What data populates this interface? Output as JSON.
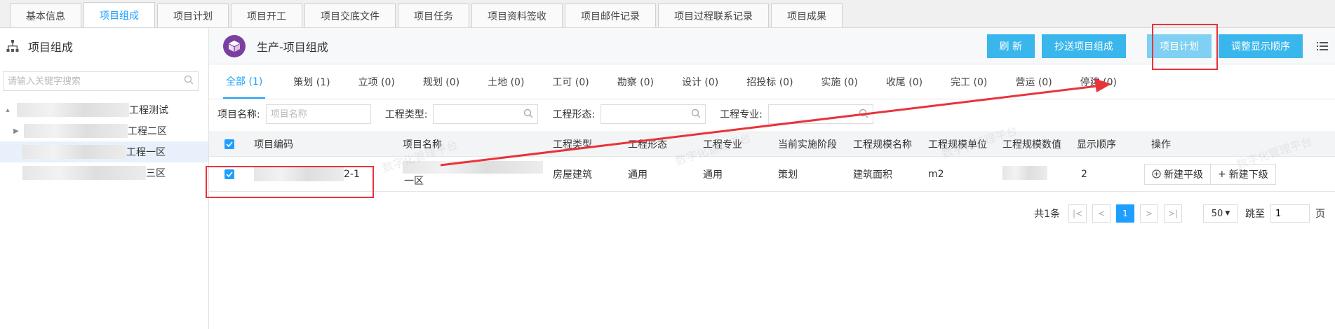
{
  "top_tabs": [
    "基本信息",
    "项目组成",
    "项目计划",
    "项目开工",
    "项目交底文件",
    "项目任务",
    "项目资料签收",
    "项目邮件记录",
    "项目过程联系记录",
    "项目成果"
  ],
  "left": {
    "title": "项目组成",
    "search_placeholder": "请输入关键字搜索",
    "nodes": [
      "工程测试",
      "工程二区",
      "工程一区",
      "三区"
    ]
  },
  "header": {
    "title": "生产-项目组成",
    "buttons": {
      "refresh": "刷 新",
      "cc": "抄送项目组成",
      "plan": "项目计划",
      "order": "调整显示顺序"
    }
  },
  "stage_tabs": [
    "全部 (1)",
    "策划 (1)",
    "立项 (0)",
    "规划 (0)",
    "土地 (0)",
    "工可 (0)",
    "勘察 (0)",
    "设计 (0)",
    "招投标 (0)",
    "实施 (0)",
    "收尾 (0)",
    "完工 (0)",
    "营运 (0)",
    "停建 (0)"
  ],
  "filters": {
    "name_label": "项目名称:",
    "name_placeholder": "项目名称",
    "type_label": "工程类型:",
    "form_label": "工程形态:",
    "spec_label": "工程专业:"
  },
  "table": {
    "columns": [
      "项目编码",
      "项目名称",
      "工程类型",
      "工程形态",
      "工程专业",
      "当前实施阶段",
      "工程规模名称",
      "工程规模单位",
      "工程规模数值",
      "显示顺序",
      "操作"
    ],
    "row": {
      "code_suffix": "2-1",
      "name_suffix": "一区",
      "type": "房屋建筑",
      "form": "通用",
      "spec": "通用",
      "stage": "策划",
      "scale_name": "建筑面积",
      "scale_unit": "m2",
      "order": "2",
      "op_same": "新建平级",
      "op_child": "新建下级"
    }
  },
  "pager": {
    "total": "共1条",
    "current": "1",
    "size": "50",
    "jump_label": "跳至",
    "jump_value": "1",
    "page_unit": "页"
  },
  "watermark": "数字化管理平台",
  "colors": {
    "accent": "#1e9fff",
    "button": "#39b6ec",
    "annotation": "#e8333a"
  }
}
